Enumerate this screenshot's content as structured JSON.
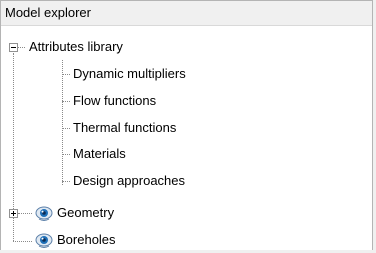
{
  "panel": {
    "title": "Model explorer"
  },
  "tree": {
    "root": {
      "label": "Attributes library",
      "expanded": true,
      "children": [
        {
          "label": "Dynamic multipliers"
        },
        {
          "label": "Flow functions"
        },
        {
          "label": "Thermal functions"
        },
        {
          "label": "Materials"
        },
        {
          "label": "Design approaches"
        }
      ]
    },
    "geometry": {
      "label": "Geometry",
      "expanded": false,
      "icon": "visibility-eye-icon"
    },
    "boreholes": {
      "label": "Boreholes",
      "icon": "visibility-eye-icon"
    }
  },
  "colors": {
    "panel_bg": "#ffffff",
    "titlebar_bg": "#f0f0f0",
    "tree_lines": "#8a8a8a",
    "eye_icon_blue": "#1e6fb8"
  }
}
